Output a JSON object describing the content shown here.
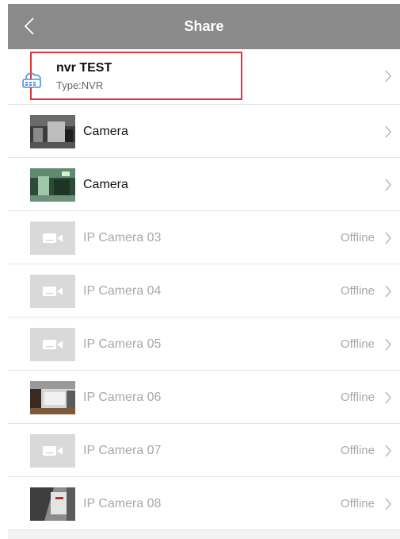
{
  "header": {
    "title": "Share",
    "back_icon": "chevron-left-icon"
  },
  "nvr": {
    "name": "nvr TEST",
    "type": "Type:NVR",
    "icon": "cloud-nvr-icon",
    "highlight_color": "#e0353b"
  },
  "channels": [
    {
      "name": "Camera",
      "status": "",
      "thumbnail": "snapshot-dark-room"
    },
    {
      "name": "Camera",
      "status": "",
      "thumbnail": "snapshot-green-room"
    },
    {
      "name": "IP Camera 03",
      "status": "Offline",
      "thumbnail": "camera-placeholder-icon"
    },
    {
      "name": "IP Camera 04",
      "status": "Offline",
      "thumbnail": "camera-placeholder-icon"
    },
    {
      "name": "IP Camera 05",
      "status": "Offline",
      "thumbnail": "camera-placeholder-icon"
    },
    {
      "name": "IP Camera 06",
      "status": "Offline",
      "thumbnail": "snapshot-office"
    },
    {
      "name": "IP Camera 07",
      "status": "Offline",
      "thumbnail": "camera-placeholder-icon"
    },
    {
      "name": "IP Camera 08",
      "status": "Offline",
      "thumbnail": "snapshot-hallway"
    }
  ],
  "colors": {
    "header_bg": "#8a8a8a",
    "offline_text": "#a8a8a8",
    "divider": "#e3e3e3"
  }
}
